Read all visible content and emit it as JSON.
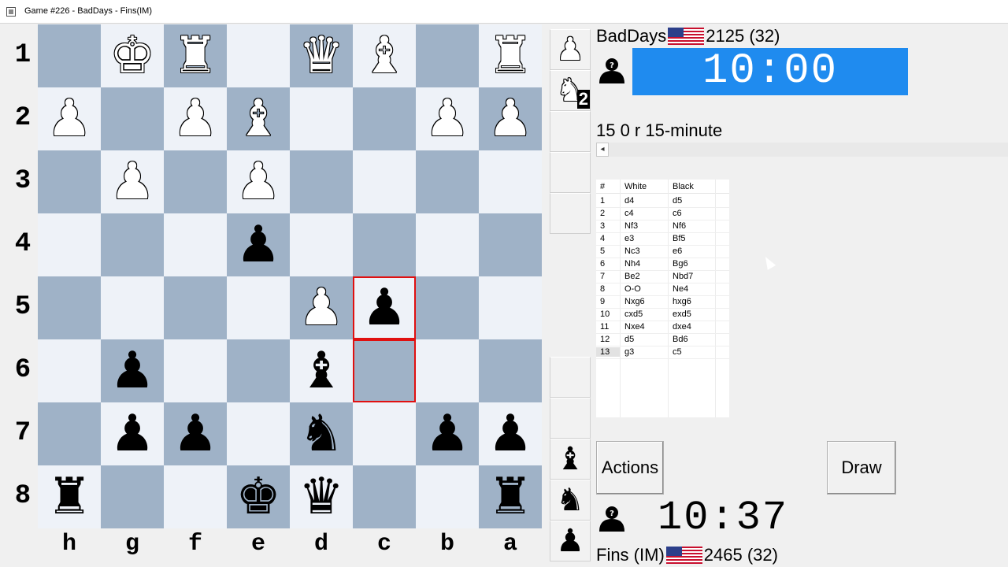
{
  "window": {
    "title": "Game #226 - BadDays - Fins(IM)"
  },
  "ranks": [
    "1",
    "2",
    "3",
    "4",
    "5",
    "6",
    "7",
    "8"
  ],
  "files": [
    "h",
    "g",
    "f",
    "e",
    "d",
    "c",
    "b",
    "a"
  ],
  "board": [
    [
      "",
      "wK",
      "wR",
      "",
      "wQ",
      "wB",
      "",
      "wR"
    ],
    [
      "wP",
      "",
      "wP",
      "wB",
      "",
      "",
      "wP",
      "wP"
    ],
    [
      "",
      "wP",
      "",
      "wP",
      "",
      "",
      "",
      ""
    ],
    [
      "",
      "",
      "",
      "bP",
      "",
      "",
      "",
      ""
    ],
    [
      "",
      "",
      "",
      "",
      "wP",
      "bP",
      "",
      ""
    ],
    [
      "",
      "bP",
      "",
      "",
      "bB",
      "",
      "",
      ""
    ],
    [
      "",
      "bP",
      "bP",
      "",
      "bN",
      "",
      "bP",
      "bP"
    ],
    [
      "bR",
      "",
      "",
      "bK",
      "bQ",
      "",
      "",
      "bR"
    ]
  ],
  "highlight_squares": [
    "c5",
    "c6"
  ],
  "captured_top": [
    {
      "piece": "wP",
      "count": ""
    },
    {
      "piece": "wN",
      "count": "2"
    }
  ],
  "captured_bottom": [
    {
      "piece": "bB",
      "count": ""
    },
    {
      "piece": "bN",
      "count": ""
    },
    {
      "piece": "bP",
      "count": ""
    }
  ],
  "top_player": {
    "name": "BadDays",
    "rating": "2125 (32)",
    "clock": "10:00",
    "avatar_icon": "unknown-player-icon",
    "flag_icon": "us-flag-icon"
  },
  "bottom_player": {
    "name": "Fins (IM)",
    "rating": "2465 (32)",
    "clock": "10:37",
    "avatar_icon": "unknown-player-icon",
    "flag_icon": "us-flag-icon"
  },
  "game_type": "15 0 r 15-minute",
  "moves_table": {
    "headers": [
      "#",
      "White",
      "Black"
    ],
    "rows": [
      [
        "1",
        "d4",
        "d5"
      ],
      [
        "2",
        "c4",
        "c6"
      ],
      [
        "3",
        "Nf3",
        "Nf6"
      ],
      [
        "4",
        "e3",
        "Bf5"
      ],
      [
        "5",
        "Nc3",
        "e6"
      ],
      [
        "6",
        "Nh4",
        "Bg6"
      ],
      [
        "7",
        "Be2",
        "Nbd7"
      ],
      [
        "8",
        "O-O",
        "Ne4"
      ],
      [
        "9",
        "Nxg6",
        "hxg6"
      ],
      [
        "10",
        "cxd5",
        "exd5"
      ],
      [
        "11",
        "Nxe4",
        "dxe4"
      ],
      [
        "12",
        "d5",
        "Bd6"
      ],
      [
        "13",
        "g3",
        "c5"
      ]
    ]
  },
  "buttons": {
    "actions": "Actions",
    "draw": "Draw"
  },
  "colors": {
    "light_square": "#eef2f8",
    "dark_square": "#9fb2c7",
    "highlight": "#e01010",
    "clock_active": "#1f8bef"
  }
}
